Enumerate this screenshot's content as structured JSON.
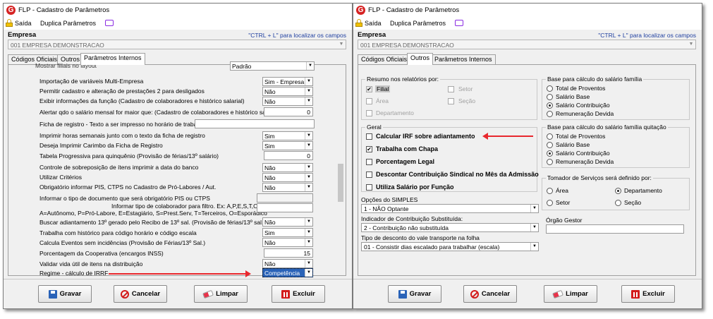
{
  "left": {
    "title": "FLP - Cadastro de Parâmetros",
    "toolbar": {
      "saida": "Saída",
      "duplica": "Duplica Parâmetros"
    },
    "empresa_label": "Empresa",
    "ctrl_hint": "\"CTRL + L\" para localizar os campos",
    "empresa_value": "001 EMPRESA DEMONSTRACAO",
    "tabs": [
      "Códigos Oficiais",
      "Outros",
      "Parâmetros Internos"
    ],
    "rows": {
      "r0": "Mostrar filiais no layout",
      "r0v": "Padrão",
      "r1": "Importação de variáveis Multi-Empresa",
      "r1v": "Sim - Empresa",
      "r2": "Permitir cadastro e alteração de prestações 2 para desligados",
      "r2v": "Não",
      "r3": "Exibir informações da função (Cadastro de colaboradores e histórico salarial)",
      "r3v": "Não",
      "r4": "Alertar qdo o salário mensal for maior que: (Cadastro de colaboradores e histórico salarial)",
      "r4v": "0",
      "r5": "Ficha de registro - Texto a ser impresso no horário de trabalho",
      "r6": "Imprimir horas semanais junto com o texto da ficha de registro",
      "r6v": "Sim",
      "r7": "Deseja Imprimir Carimbo da Ficha de Registro",
      "r7v": "Sim",
      "r8": "Tabela Progressiva para quinquênio (Provisão de férias/13º salário)",
      "r8v": "0",
      "r9": "Controle de sobreposição de ítens imprimir a data do banco",
      "r9v": "Não",
      "r10": "Utilizar Critérios",
      "r10v": "Não",
      "r11": "Obrigatório informar PIS, CTPS no Cadastro de  Pró-Labores / Aut.",
      "r11v": "Não",
      "r12": "Informar o tipo de documento que será obrigatório PIS ou CTPS",
      "r13a": "Informar tipo de colaborador para filtro. Ex: A,P,E,S,T,O",
      "r13b": "A=Autônomo, P=Pró-Labore, E=Estagiário, S=Prest.Serv, T=Terceiros, O=Esporádico",
      "r14": "Buscar adiantamento 13º  gerado pelo Recibo de 13º sal. (Provisão de férias/13º sal.)",
      "r14v": "Não",
      "r15": "Trabalha com histórico para código horário e código escala",
      "r15v": "Sim",
      "r16": "Calcula Eventos sem incidências (Provisão de Férias/13º Sal.)",
      "r16v": "Não",
      "r17": "Porcentagem da Cooperativa (encargos INSS)",
      "r17v": "15",
      "r18": "Validar vida útil de itens na distribuição",
      "r18v": "Não",
      "r19": "Regime - cálculo de IRRF",
      "r19v": "Competência"
    }
  },
  "right": {
    "title": "FLP - Cadastro de Parâmetros",
    "toolbar": {
      "saida": "Saída",
      "duplica": "Duplica Parâmetros"
    },
    "empresa_label": "Empresa",
    "ctrl_hint": "\"CTRL + L\" para localizar os campos",
    "empresa_value": "001 EMPRESA DEMONSTRACAO",
    "tabs": [
      "Códigos Oficiais",
      "Outros",
      "Parâmetros Internos"
    ],
    "resumo": {
      "label": "Resumo nos relatórios por:",
      "filial": "Filial",
      "setor": "Setor",
      "area": "Área",
      "secao": "Seção",
      "departamento": "Departamento"
    },
    "familia": {
      "label": "Base para cálculo do salário família",
      "opts": [
        "Total de Proventos",
        "Salário Base",
        "Salário Contribuição",
        "Remuneração Devida"
      ]
    },
    "familia_quit": {
      "label": "Base para cálculo do salário família quitação",
      "opts": [
        "Total de Proventos",
        "Salário Base",
        "Salário Contribuição",
        "Remuneração Devida"
      ]
    },
    "geral": {
      "label": "Geral",
      "items": [
        "Calcular IRF sobre adiantamento",
        "Trabalha com Chapa",
        "Porcentagem Legal",
        "Descontar Contribuição Sindical no Mês da  Admissão",
        "Utiliza Salário por Função"
      ]
    },
    "tomador": {
      "label": "Tomador de Serviços será definido por:",
      "area": "Área",
      "departamento": "Departamento",
      "setor": "Setor",
      "secao": "Seção"
    },
    "simples": {
      "label": "Opções do SIMPLES",
      "value": "1 - NÃO Optante"
    },
    "substitutiva": {
      "label": "Indicador de Contribuição Substituída:",
      "value": "2 - Contribuição não substituída"
    },
    "orgao": {
      "label": "Órgão Gestor",
      "value": ""
    },
    "vale": {
      "label": "Tipo de desconto do vale transporte na folha",
      "value": "01 - Consistir dias escalado para trabalhar (escala)"
    }
  },
  "buttons": {
    "gravar": "Gravar",
    "cancelar": "Cancelar",
    "limpar": "Limpar",
    "excluir": "Excluir"
  },
  "colors": {
    "accent_red": "#e8282e",
    "logo_red": "#d62323",
    "hint_blue": "#1f3fa0"
  }
}
